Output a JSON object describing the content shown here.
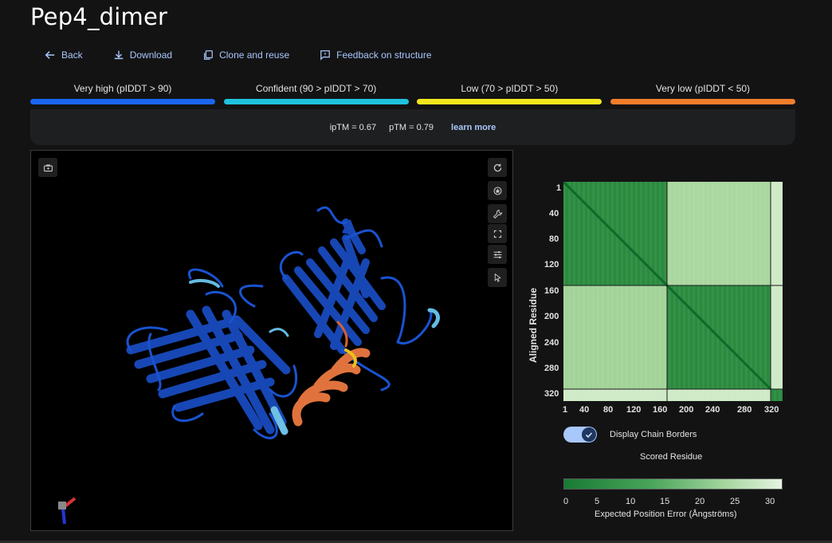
{
  "title": "Pep4_dimer",
  "toolbar": {
    "back": "Back",
    "download": "Download",
    "clone": "Clone and reuse",
    "feedback": "Feedback on structure"
  },
  "legend": [
    {
      "label": "Very high (pIDDT > 90)",
      "color": "#1a66f0"
    },
    {
      "label": "Confident (90 > pIDDT > 70)",
      "color": "#1fc2de"
    },
    {
      "label": "Low (70 > pIDDT > 50)",
      "color": "#f5e71d"
    },
    {
      "label": "Very low (pIDDT < 50)",
      "color": "#f07d2a"
    }
  ],
  "metrics": {
    "iptm": "ipTM = 0.67",
    "ptm": "pTM = 0.79",
    "learn_more": "learn more"
  },
  "pae": {
    "y_axis_label": "Aligned Residue",
    "x_axis_label": "Scored Residue",
    "y_ticks": [
      "1",
      "40",
      "80",
      "120",
      "160",
      "200",
      "240",
      "280",
      "320"
    ],
    "x_ticks": [
      "1",
      "40",
      "80",
      "120",
      "160",
      "200",
      "240",
      "280",
      "320"
    ],
    "toggle_label": "Display Chain Borders",
    "toggle_on": true,
    "colorbar_ticks": [
      "0",
      "5",
      "10",
      "15",
      "20",
      "25",
      "30"
    ],
    "colorbar_title": "Expected Position Error (Ångströms)"
  },
  "colors": {
    "accent": "#a8c7fa",
    "background": "#131314"
  }
}
